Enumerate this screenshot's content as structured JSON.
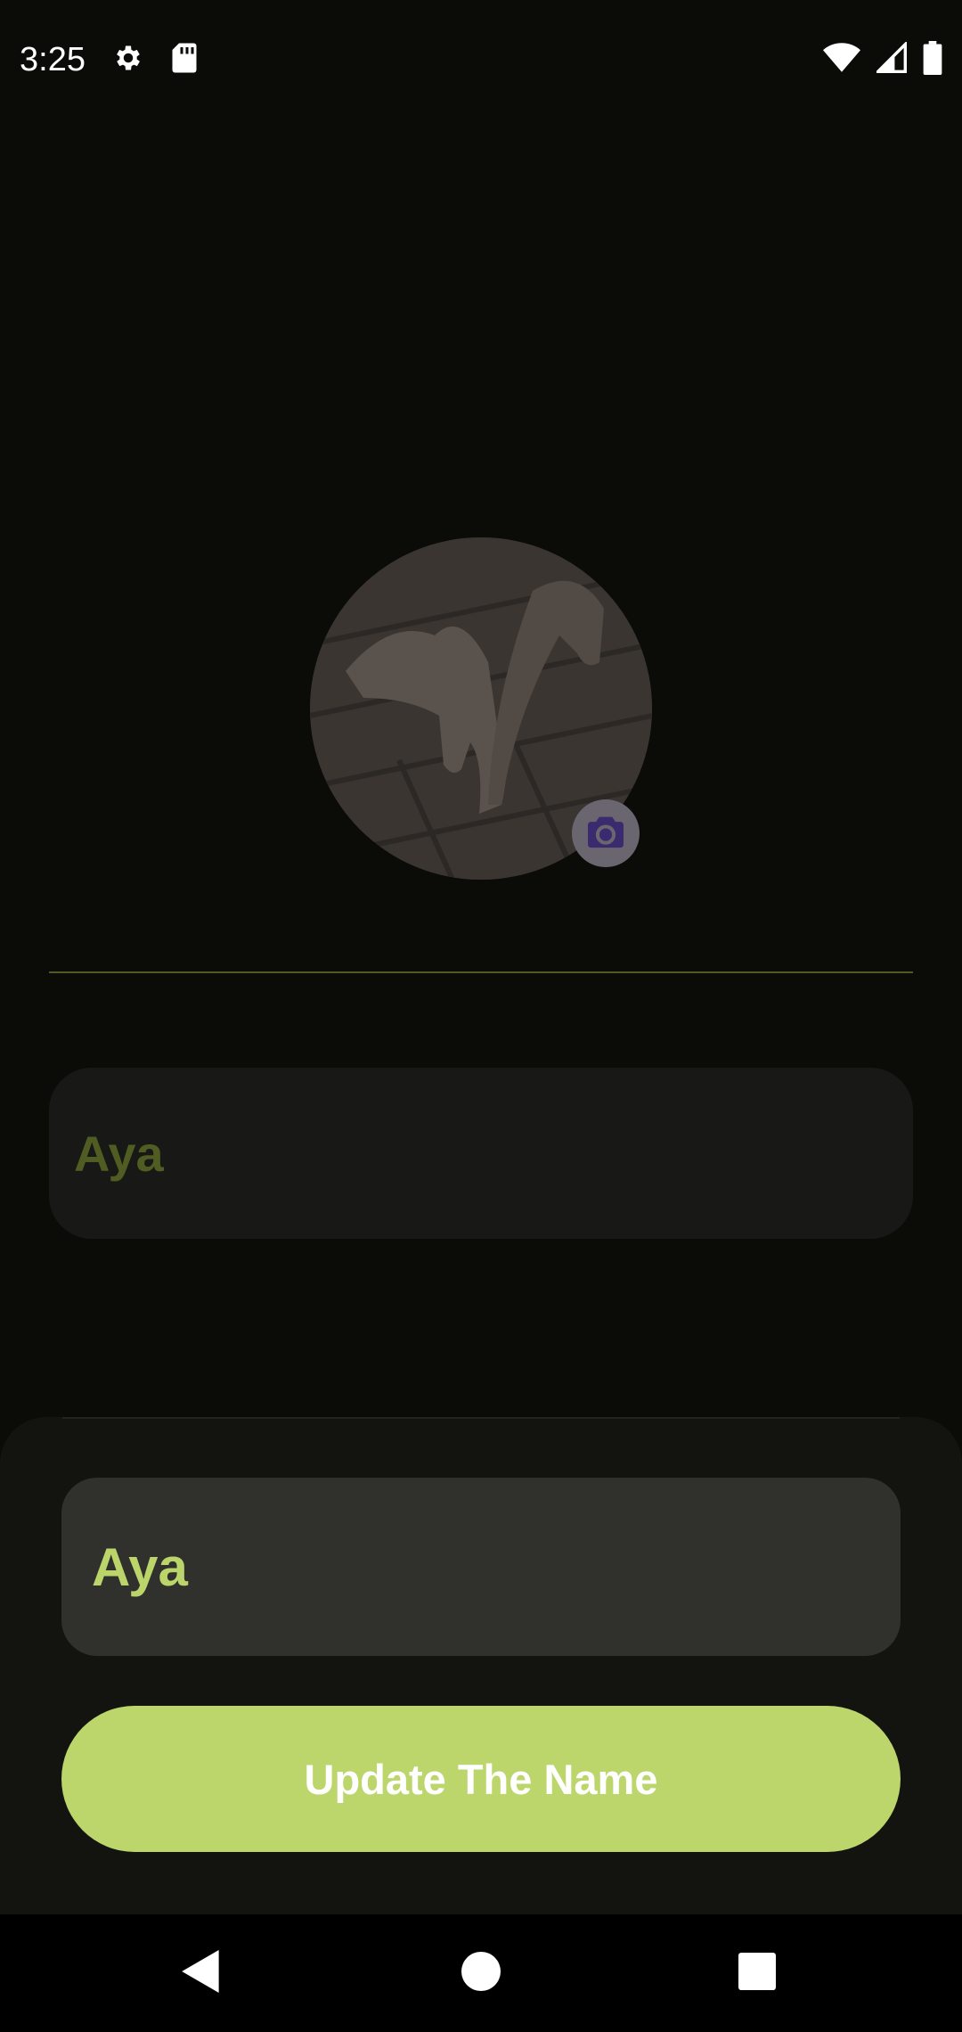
{
  "status_bar": {
    "time": "3:25",
    "icons": [
      "gear-icon",
      "sd-card-icon",
      "wifi-icon",
      "signal-icon",
      "battery-icon"
    ]
  },
  "profile": {
    "avatar_description_icon": "dog-photo",
    "camera_icon": "camera-icon",
    "name_display": "Aya"
  },
  "bottom_sheet": {
    "name_input_value": "Aya",
    "update_button_label": "Update The Name"
  },
  "navigation": {
    "icons": [
      "back-icon",
      "home-icon",
      "recents-icon"
    ]
  },
  "colors": {
    "background": "#0b0b08",
    "accent": "#bcd66b",
    "accent_text": "#bbd56a",
    "muted_accent": "#4f5d22"
  }
}
